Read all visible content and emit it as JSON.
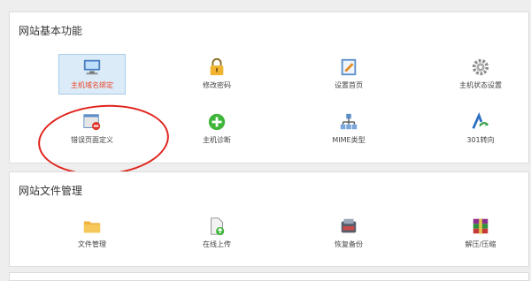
{
  "colors": {
    "accent": "#e8442a",
    "annotation_ring": "#e0241d",
    "selected_bg": "#dcebf8"
  },
  "sections": [
    {
      "title": "网站基本功能",
      "items": [
        {
          "label": "主机域名绑定",
          "icon": "computer-icon",
          "selected": true
        },
        {
          "label": "修改密码",
          "icon": "lock-icon"
        },
        {
          "label": "设置首页",
          "icon": "settings-page-icon"
        },
        {
          "label": "主机状态设置",
          "icon": "gear-icon"
        },
        {
          "label": "错误页面定义",
          "icon": "error-page-icon"
        },
        {
          "label": "主机诊断",
          "icon": "add-icon"
        },
        {
          "label": "MIME类型",
          "icon": "network-icon"
        },
        {
          "label": "301转向",
          "icon": "redirect-icon"
        }
      ]
    },
    {
      "title": "网站文件管理",
      "items": [
        {
          "label": "文件管理",
          "icon": "folder-icon"
        },
        {
          "label": "在线上传",
          "icon": "upload-icon"
        },
        {
          "label": "恢复备份",
          "icon": "backup-icon"
        },
        {
          "label": "解压/压缩",
          "icon": "archive-icon"
        }
      ]
    }
  ]
}
